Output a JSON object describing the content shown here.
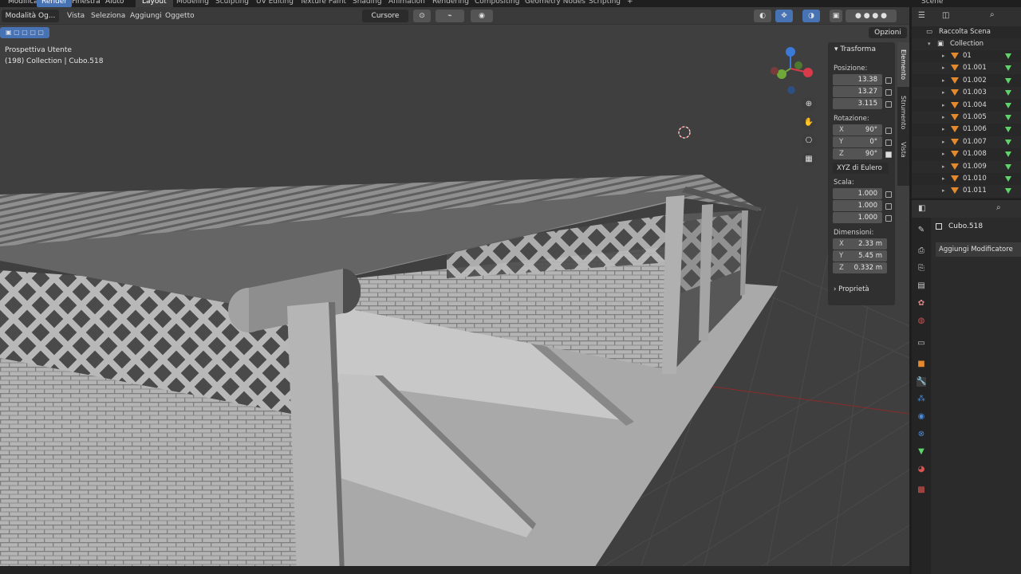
{
  "topbar": {
    "menus": [
      "Modifica",
      "Render",
      "Finestra",
      "Aiuto"
    ],
    "active_menu": "Render",
    "workspaces": [
      "Layout",
      "Modeling",
      "Sculpting",
      "UV Editing",
      "Texture Paint",
      "Shading",
      "Animation",
      "Rendering",
      "Compositing",
      "Geometry Nodes",
      "Scripting"
    ],
    "active_workspace": "Layout",
    "add_tab": "+",
    "scene_label": "Scene"
  },
  "viewport_header": {
    "mode": "Modalità Og...",
    "menus": [
      "Vista",
      "Seleziona",
      "Aggiungi",
      "Oggetto"
    ],
    "cursor_label": "Cursore",
    "options_label": "Opzioni"
  },
  "overlay": {
    "view_name": "Prospettiva Utente",
    "collection_info": "(198) Collection | Cubo.518"
  },
  "npanel": {
    "transform_header": "Trasforma",
    "position_label": "Posizione:",
    "position": [
      "13.38",
      "13.27",
      "3.115"
    ],
    "rotation_label": "Rotazione:",
    "rotation": [
      {
        "axis": "X",
        "value": "90°"
      },
      {
        "axis": "Y",
        "value": "0°"
      },
      {
        "axis": "Z",
        "value": "90°"
      }
    ],
    "rotation_mode": "XYZ di Eulero",
    "scale_label": "Scala:",
    "scale": [
      "1.000",
      "1.000",
      "1.000"
    ],
    "dimensions_label": "Dimensioni:",
    "dimensions": [
      {
        "axis": "X",
        "value": "2.33 m"
      },
      {
        "axis": "Y",
        "value": "5.45 m"
      },
      {
        "axis": "Z",
        "value": "0.332 m"
      }
    ],
    "properties_label": "Proprietà",
    "tabs": [
      "Elemento",
      "Strumento",
      "Vista"
    ]
  },
  "outliner": {
    "scene_collection": "Raccolta Scena",
    "collection": "Collection",
    "items": [
      "01",
      "01.001",
      "01.002",
      "01.003",
      "01.004",
      "01.005",
      "01.006",
      "01.007",
      "01.008",
      "01.009",
      "01.010",
      "01.011"
    ]
  },
  "properties": {
    "object_name": "Cubo.518",
    "add_modifier": "Aggiungi Modificatore"
  },
  "colors": {
    "accent": "#4772b3",
    "mesh_icon": "#e58a2c",
    "data_icon": "#5fd46a"
  }
}
